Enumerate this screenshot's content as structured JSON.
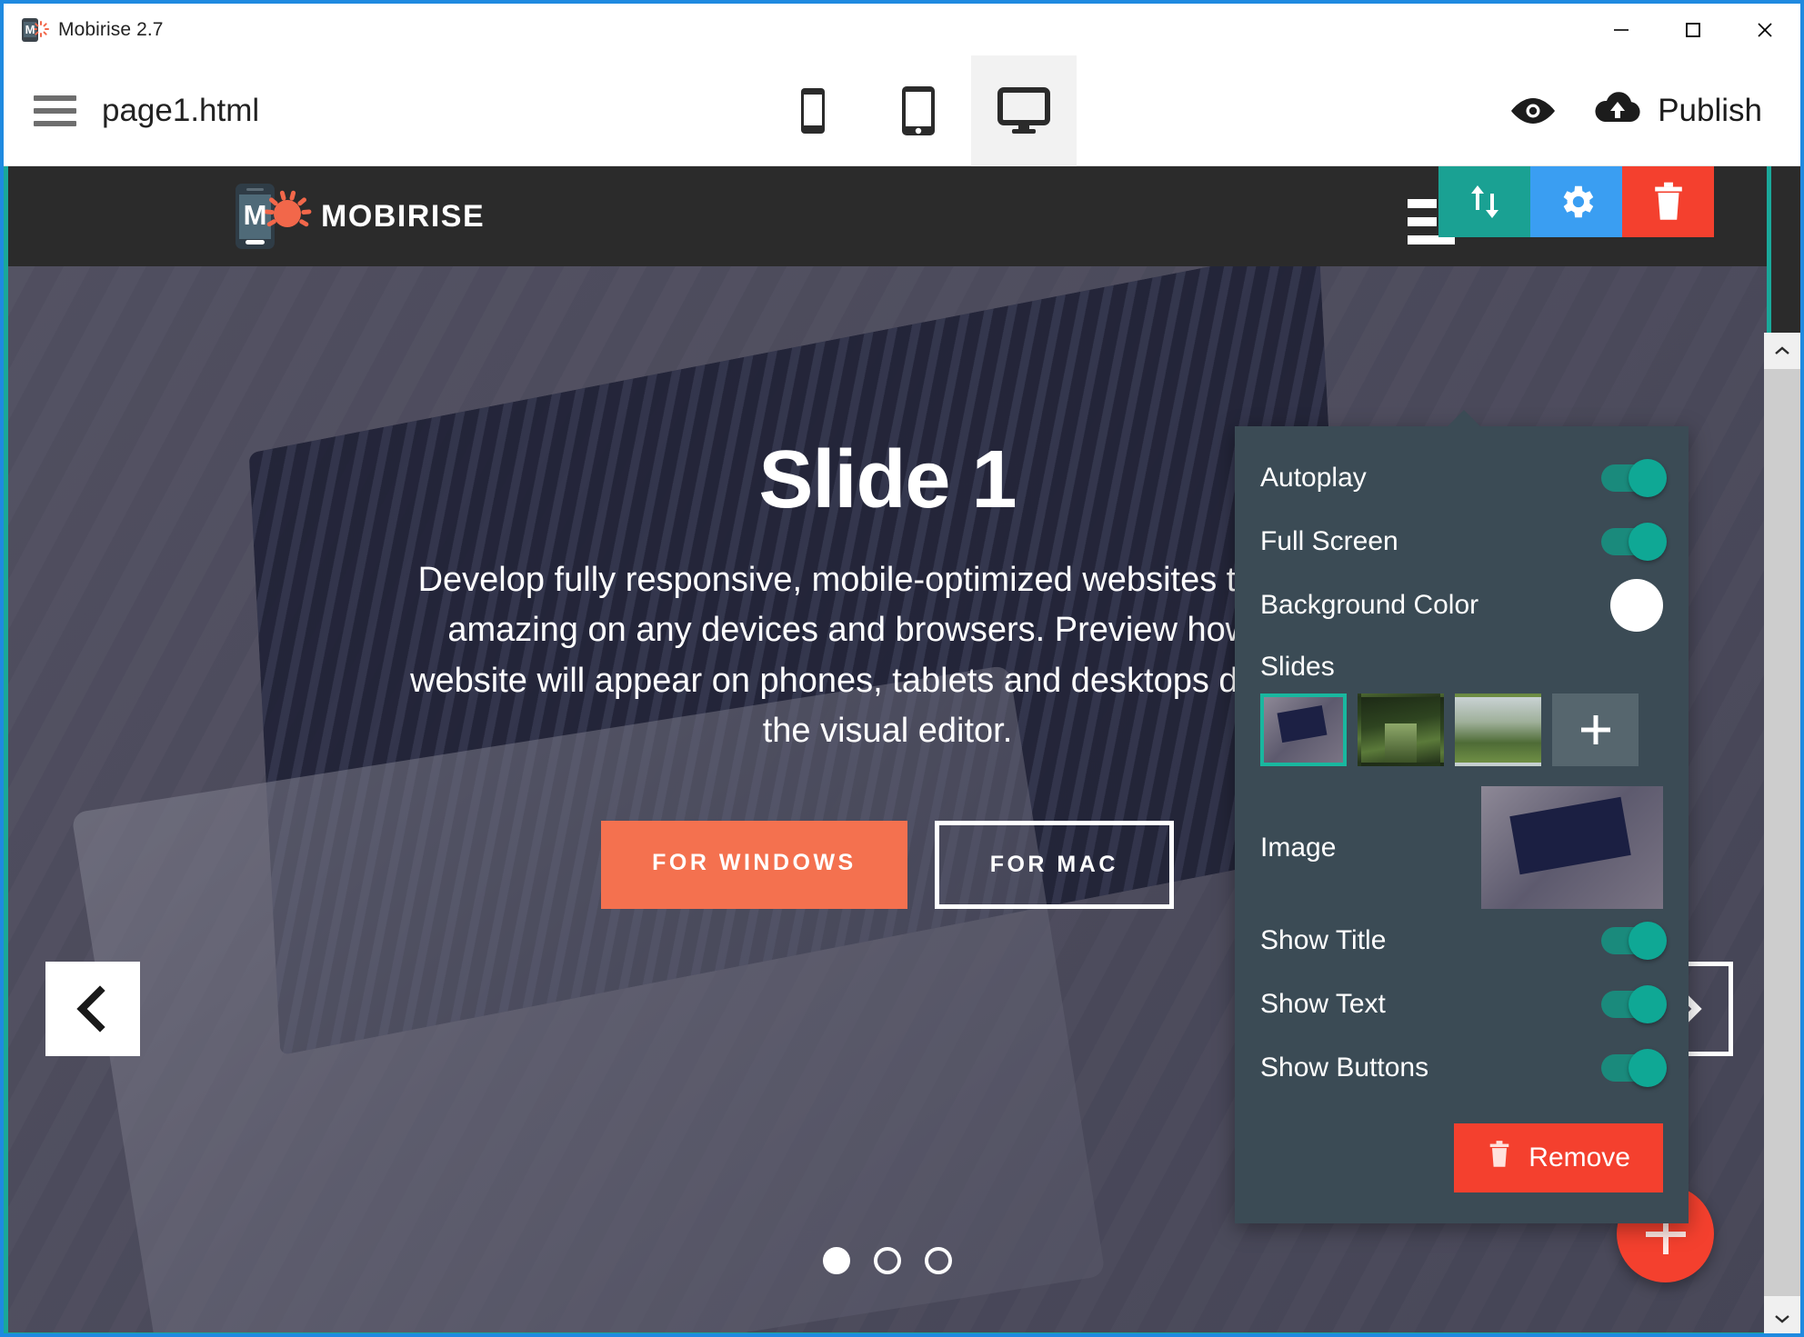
{
  "window": {
    "title": "Mobirise 2.7",
    "icon": "mobirise-app-icon",
    "controls": {
      "minimize": "minimize-icon",
      "maximize": "maximize-icon",
      "close": "close-icon"
    }
  },
  "toolbar": {
    "menu_icon": "hamburger-menu-icon",
    "filename": "page1.html",
    "devices": [
      {
        "name": "phone",
        "icon": "phone-icon",
        "active": false
      },
      {
        "name": "tablet",
        "icon": "tablet-icon",
        "active": false
      },
      {
        "name": "desktop",
        "icon": "desktop-icon",
        "active": true
      }
    ],
    "preview_icon": "eye-icon",
    "publish_icon": "cloud-upload-icon",
    "publish_label": "Publish"
  },
  "site": {
    "brand": "MOBIRISE",
    "logo_letter": "M"
  },
  "section_tools": {
    "move_icon": "move-up-down-icon",
    "settings_icon": "gear-icon",
    "delete_icon": "trash-icon",
    "drag_handle": "drag-handle-icon",
    "colors": {
      "move": "#1aa193",
      "settings": "#3a9ef2",
      "delete": "#f4402e"
    }
  },
  "hero": {
    "title": "Slide 1",
    "text": "Develop fully responsive, mobile-optimized websites that look amazing on any devices and browsers. Preview how your website will appear on phones, tablets and desktops directly in the visual editor.",
    "buttons": {
      "windows": "FOR WINDOWS",
      "mac": "FOR MAC"
    },
    "button_colors": {
      "windows_bg": "#f4714f",
      "mac_border": "#ffffff"
    },
    "prev_icon": "chevron-left-icon",
    "next_icon": "chevron-right-icon",
    "dots": [
      {
        "active": true
      },
      {
        "active": false
      },
      {
        "active": false
      }
    ],
    "add_block_icon": "plus-icon",
    "add_block_color": "#f4402e"
  },
  "settings_panel": {
    "rows": [
      {
        "label": "Autoplay",
        "type": "toggle",
        "value": true
      },
      {
        "label": "Full Screen",
        "type": "toggle",
        "value": true
      },
      {
        "label": "Background Color",
        "type": "color",
        "value": "#ffffff"
      }
    ],
    "slides_label": "Slides",
    "slides": [
      {
        "name": "slide-thumb-laptop",
        "selected": true
      },
      {
        "name": "slide-thumb-forest",
        "selected": false
      },
      {
        "name": "slide-thumb-hills",
        "selected": false
      }
    ],
    "add_slide_icon": "plus-icon",
    "image_label": "Image",
    "image_preview": "slide-image-preview",
    "toggles": [
      {
        "label": "Show Title",
        "value": true
      },
      {
        "label": "Show Text",
        "value": true
      },
      {
        "label": "Show Buttons",
        "value": true
      }
    ],
    "remove_label": "Remove",
    "remove_icon": "trash-icon",
    "accent_on": "#0fa895",
    "panel_bg": "#3b4b55",
    "selected_border": "#19b79f"
  },
  "scrollbar": {
    "up_icon": "chevron-up-icon",
    "down_icon": "chevron-down-icon"
  }
}
